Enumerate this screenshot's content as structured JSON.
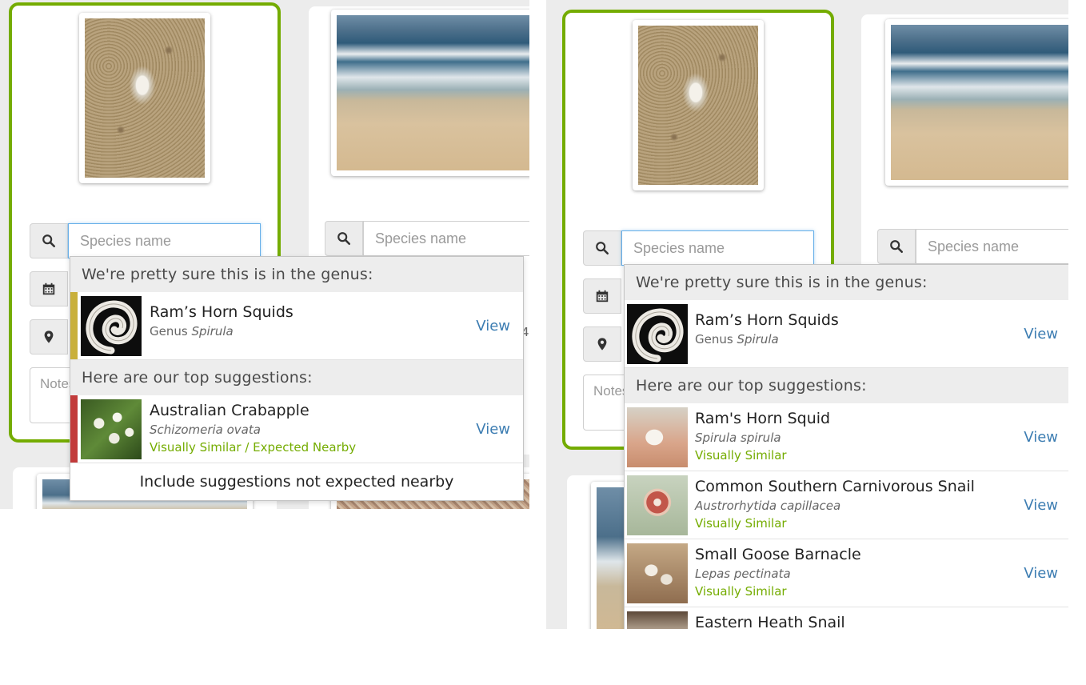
{
  "search": {
    "placeholder": "Species name"
  },
  "notes": {
    "placeholder": "Notes"
  },
  "panel_left": {
    "dropdown": {
      "genus_header": "We're pretty sure this is in the genus:",
      "genus": {
        "name": "Ram’s Horn Squids",
        "rank": "Genus",
        "scientific": "Spirula",
        "view": "View",
        "bar_color": "#c9b03c"
      },
      "suggestions_header": "Here are our top suggestions:",
      "suggestions": [
        {
          "name": "Australian Crabapple",
          "scientific": "Schizomeria ovata",
          "tag": "Visually Similar / Expected Nearby",
          "view": "View",
          "bar_color": "#c23b3b"
        }
      ],
      "footer": "Include suggestions not expected nearby"
    },
    "partial_digit": "4"
  },
  "panel_right": {
    "dropdown": {
      "genus_header": "We're pretty sure this is in the genus:",
      "genus": {
        "name": "Ram’s Horn Squids",
        "rank": "Genus",
        "scientific": "Spirula",
        "view": "View"
      },
      "suggestions_header": "Here are our top suggestions:",
      "suggestions": [
        {
          "name": "Ram's Horn Squid",
          "scientific": "Spirula spirula",
          "tag": "Visually Similar",
          "view": "View"
        },
        {
          "name": "Common Southern Carnivorous Snail",
          "scientific": "Austrorhytida capillacea",
          "tag": "Visually Similar",
          "view": "View"
        },
        {
          "name": "Small Goose Barnacle",
          "scientific": "Lepas pectinata",
          "tag": "Visually Similar",
          "view": "View"
        },
        {
          "name": "Eastern Heath Snail"
        }
      ]
    }
  },
  "colors": {
    "selected_border": "#74ac00",
    "link": "#3d7db2",
    "tag": "#74ac00",
    "focus": "#66afe9"
  },
  "icons": {
    "search": "search-icon",
    "calendar": "calendar-icon",
    "location": "map-marker-icon"
  }
}
